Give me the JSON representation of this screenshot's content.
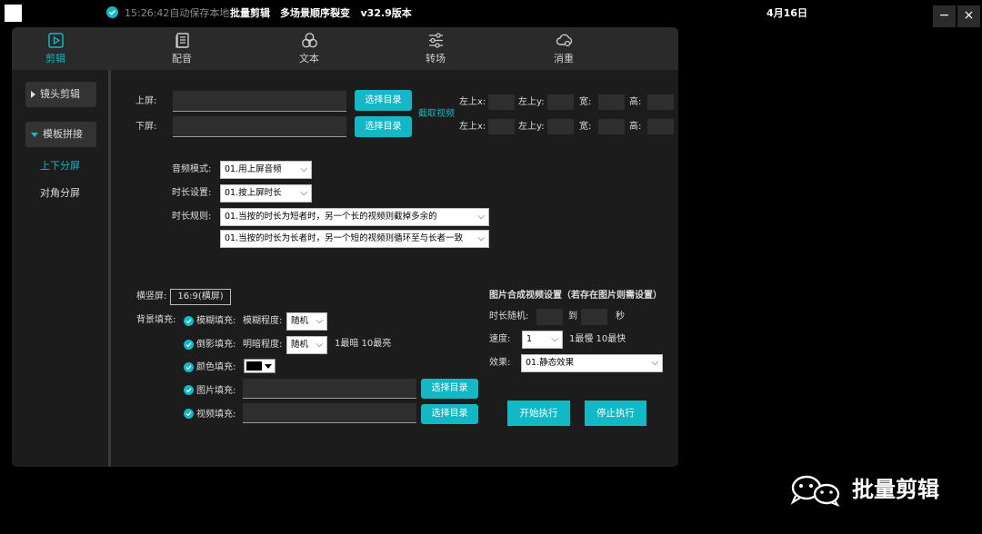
{
  "topbar": {
    "saved_text": "15:26:42自动保存本地",
    "app_name": "批量剪辑",
    "app_subtitle": "多场景顺序裂变",
    "version": "v32.9版本",
    "date": "4月16日",
    "minimize": "−",
    "close": "×"
  },
  "tabs": [
    {
      "label": "剪辑",
      "icon": "play-square-icon",
      "active": true
    },
    {
      "label": "配音",
      "icon": "document-icon",
      "active": false
    },
    {
      "label": "文本",
      "icon": "three-circles-icon",
      "active": false
    },
    {
      "label": "转场",
      "icon": "sliders-icon",
      "active": false
    },
    {
      "label": "消重",
      "icon": "cloud-icon",
      "active": false
    }
  ],
  "sidebar": {
    "shot_edit": "镜头剪辑",
    "template_splice": "模板拼接",
    "split_updown": "上下分屏",
    "split_diagonal": "对角分屏"
  },
  "screens": {
    "top_label": "上屏:",
    "bottom_label": "下屏:",
    "choose_dir": "选择目录",
    "crop_video": "截取视频",
    "left_x": "左上x:",
    "left_y": "左上y:",
    "width": "宽:",
    "height": "高:"
  },
  "audio": {
    "mode_label": "音频模式:",
    "mode_value": "01.用上屏音频",
    "duration_label": "时长设置:",
    "duration_value": "01.按上屏时长",
    "rule_label": "时长规则:",
    "rule1_value": "01.当按的时长为短者时，另一个长的视频则截掉多余的",
    "rule2_value": "01.当按的时长为长者时，另一个短的视频则循环至与长者一致"
  },
  "background": {
    "orientation_label": "横竖屏:",
    "orientation_value": "16:9(横屏)",
    "fill_label": "背景填充:",
    "blur_fill": "模糊填充:",
    "blur_degree_label": "模糊程度:",
    "blur_degree_value": "随机",
    "reflect_fill": "倒影填充:",
    "brightness_label": "明暗程度:",
    "brightness_value": "随机",
    "brightness_hint": "1最暗 10最亮",
    "color_fill": "颜色填充:",
    "image_fill": "图片填充:",
    "video_fill": "视频填充:",
    "choose_dir": "选择目录"
  },
  "image_video": {
    "title": "图片合成视频设置（若存在图片则需设置）",
    "duration_label": "时长随机:",
    "to": "到",
    "seconds": "秒",
    "speed_label": "速度:",
    "speed_value": "1",
    "speed_hint": "1最慢 10最快",
    "effect_label": "效果:",
    "effect_value": "01.静态效果"
  },
  "actions": {
    "start": "开始执行",
    "stop": "停止执行"
  },
  "watermark": {
    "text": "批量剪辑",
    "icon": "wechat-icon"
  },
  "colors": {
    "accent": "#13b8c7",
    "panel": "#1c1c1c",
    "tabbar": "#2a2a2a"
  }
}
